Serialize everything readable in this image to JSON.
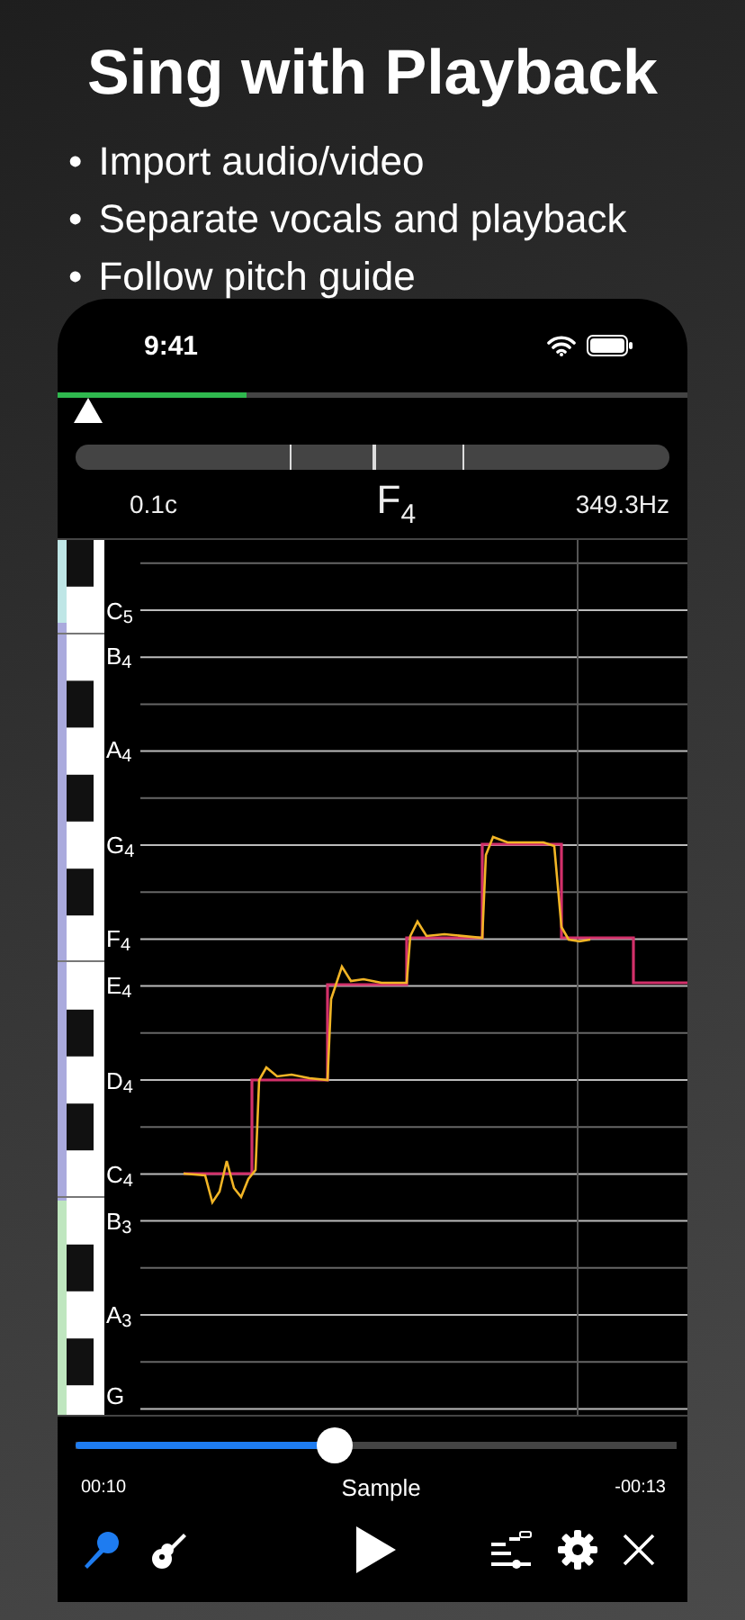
{
  "headline": "Sing with Playback",
  "features": [
    {
      "marker": "•",
      "text": "Import audio/video"
    },
    {
      "marker": "•",
      "text": "Separate vocals and playback"
    },
    {
      "marker": "•",
      "text": "Follow pitch guide"
    }
  ],
  "status_bar": {
    "time": "9:41"
  },
  "song_progress": {
    "level": 0.3
  },
  "tuner": {
    "cents": "0.1c",
    "note": "F$_{4}$",
    "frequency": "349.3Hz"
  },
  "note_labels": [
    "C$_{5}$",
    "B$_{4}$",
    "A$_{4}$",
    "G$_{4}$",
    "F$_{4}$",
    "E$_{4}$",
    "D$_{4}$",
    "C$_{4}$",
    "B$_{3}$",
    "A$_{3}$",
    "G"
  ],
  "player": {
    "level": 0.43,
    "elapsed": "00:10",
    "title": "Sample",
    "remaining": "-00:13"
  },
  "tracks": [
    {
      "kind": "vocals",
      "selected": true
    },
    {
      "kind": "guitar",
      "selected": false
    }
  ]
}
